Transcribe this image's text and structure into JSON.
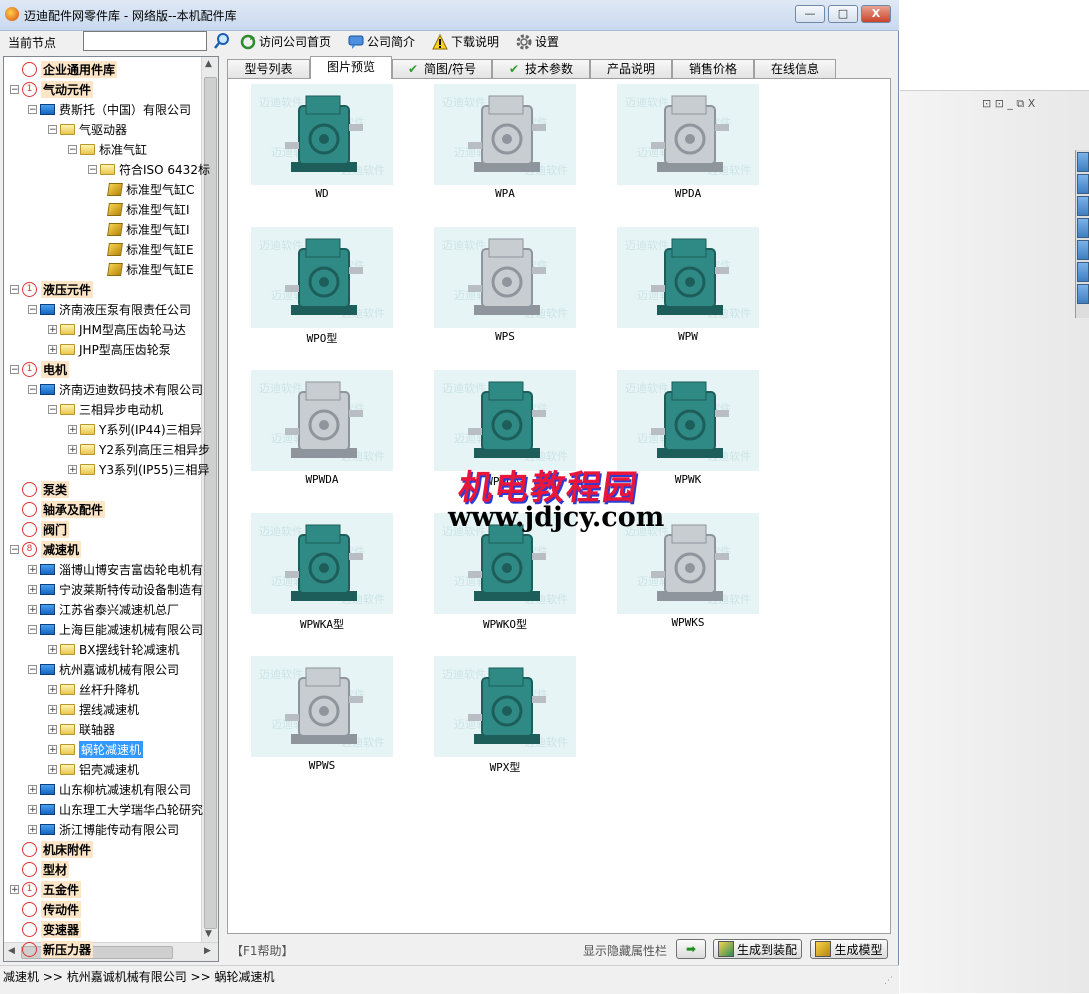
{
  "window": {
    "title": "迈迪配件网零件库 - 网络版--本机配件库",
    "controls": {
      "minimize": "—",
      "maximize": "□",
      "close": "X"
    }
  },
  "toolbar": {
    "current_node_label": "当前节点",
    "current_node_value": "",
    "visit_home": "访问公司首页",
    "company_intro": "公司简介",
    "download_help": "下载说明",
    "settings": "设置"
  },
  "tree": {
    "rows": [
      {
        "type": "cat",
        "text": "企业通用件库",
        "badge": ""
      },
      {
        "type": "cat",
        "text": "气动元件",
        "badge": "1"
      },
      {
        "type": "pc",
        "text": "费斯托（中国）有限公司"
      },
      {
        "type": "folder",
        "text": "气驱动器"
      },
      {
        "type": "folder",
        "text": "标准气缸"
      },
      {
        "type": "folder",
        "text": "符合ISO 6432标"
      },
      {
        "type": "part",
        "text": "标准型气缸C"
      },
      {
        "type": "part",
        "text": "标准型气缸I"
      },
      {
        "type": "part",
        "text": "标准型气缸I"
      },
      {
        "type": "part",
        "text": "标准型气缸E"
      },
      {
        "type": "part",
        "text": "标准型气缸E"
      },
      {
        "type": "cat",
        "text": "液压元件",
        "badge": "1"
      },
      {
        "type": "pc",
        "text": "济南液压泵有限责任公司"
      },
      {
        "type": "folder",
        "text": "JHM型高压齿轮马达"
      },
      {
        "type": "folder",
        "text": "JHP型高压齿轮泵"
      },
      {
        "type": "cat",
        "text": "电机",
        "badge": "1"
      },
      {
        "type": "pc",
        "text": "济南迈迪数码技术有限公司"
      },
      {
        "type": "folder",
        "text": "三相异步电动机"
      },
      {
        "type": "folder",
        "text": "Y系列(IP44)三相异"
      },
      {
        "type": "folder",
        "text": "Y2系列高压三相异步"
      },
      {
        "type": "folder",
        "text": "Y3系列(IP55)三相异"
      },
      {
        "type": "cat",
        "text": "泵类",
        "badge": ""
      },
      {
        "type": "cat",
        "text": "轴承及配件",
        "badge": ""
      },
      {
        "type": "cat",
        "text": "阀门",
        "badge": ""
      },
      {
        "type": "cat",
        "text": "减速机",
        "badge": "8"
      },
      {
        "type": "pc",
        "text": "淄博山博安吉富齿轮电机有"
      },
      {
        "type": "pc",
        "text": "宁波莱斯特传动设备制造有"
      },
      {
        "type": "pc",
        "text": "江苏省泰兴减速机总厂"
      },
      {
        "type": "pc",
        "text": "上海巨能减速机械有限公司"
      },
      {
        "type": "folder",
        "text": "BX摆线针轮减速机"
      },
      {
        "type": "pc",
        "text": "杭州嘉诚机械有限公司"
      },
      {
        "type": "folder",
        "text": "丝杆升降机"
      },
      {
        "type": "folder",
        "text": "摆线减速机"
      },
      {
        "type": "folder",
        "text": "联轴器"
      },
      {
        "type": "folder",
        "text": "蜗轮减速机"
      },
      {
        "type": "folder",
        "text": "铝壳减速机"
      },
      {
        "type": "pc",
        "text": "山东柳杭减速机有限公司"
      },
      {
        "type": "pc",
        "text": "山东理工大学瑞华凸轮研究"
      },
      {
        "type": "pc",
        "text": "浙江博能传动有限公司"
      },
      {
        "type": "cat",
        "text": "机床附件",
        "badge": ""
      },
      {
        "type": "cat",
        "text": "型材",
        "badge": ""
      },
      {
        "type": "cat",
        "text": "五金件",
        "badge": "1"
      },
      {
        "type": "cat",
        "text": "传动件",
        "badge": ""
      },
      {
        "type": "cat",
        "text": "变速器",
        "badge": ""
      },
      {
        "type": "cat",
        "text": "新压力器",
        "badge": ""
      }
    ]
  },
  "tabs": [
    {
      "label": "型号列表"
    },
    {
      "label": "图片预览"
    },
    {
      "label": "简图/符号"
    },
    {
      "label": "技术参数"
    },
    {
      "label": "产品说明"
    },
    {
      "label": "销售价格"
    },
    {
      "label": "在线信息"
    }
  ],
  "thumbs": [
    {
      "caption": "WD",
      "color": "teal"
    },
    {
      "caption": "WPA",
      "color": "grey"
    },
    {
      "caption": "WPDA",
      "color": "grey"
    },
    {
      "caption": "WPO型",
      "color": "teal"
    },
    {
      "caption": "WPS",
      "color": "grey"
    },
    {
      "caption": "WPW",
      "color": "teal"
    },
    {
      "caption": "WPWDA",
      "color": "grey"
    },
    {
      "caption": "WPWO型",
      "color": "teal"
    },
    {
      "caption": "WPWK",
      "color": "teal"
    },
    {
      "caption": "WPWKA型",
      "color": "teal"
    },
    {
      "caption": "WPWKO型",
      "color": "teal"
    },
    {
      "caption": "WPWKS",
      "color": "grey"
    },
    {
      "caption": "WPWS",
      "color": "grey"
    },
    {
      "caption": "WPX型",
      "color": "teal"
    }
  ],
  "thumb_watermark": "迈迪软件",
  "overlay": {
    "title": "机电教程园",
    "url": "www.jdjcy.com"
  },
  "bottom": {
    "help": "【F1帮助】",
    "toggle_props": "显示隐藏属性栏",
    "gen_assembly": "生成到装配",
    "gen_model": "生成模型"
  },
  "status": {
    "path": "减速机 >> 杭州嘉诚机械有限公司 >> 蜗轮减速机"
  },
  "colors": {
    "teal": "#2f8a86",
    "grey": "#c8cdd2",
    "selected": "#3399ff",
    "category_bg": "#fde6c8"
  },
  "right_panel": {
    "controls": "⊡ ⊡ _ ⧉ X"
  }
}
